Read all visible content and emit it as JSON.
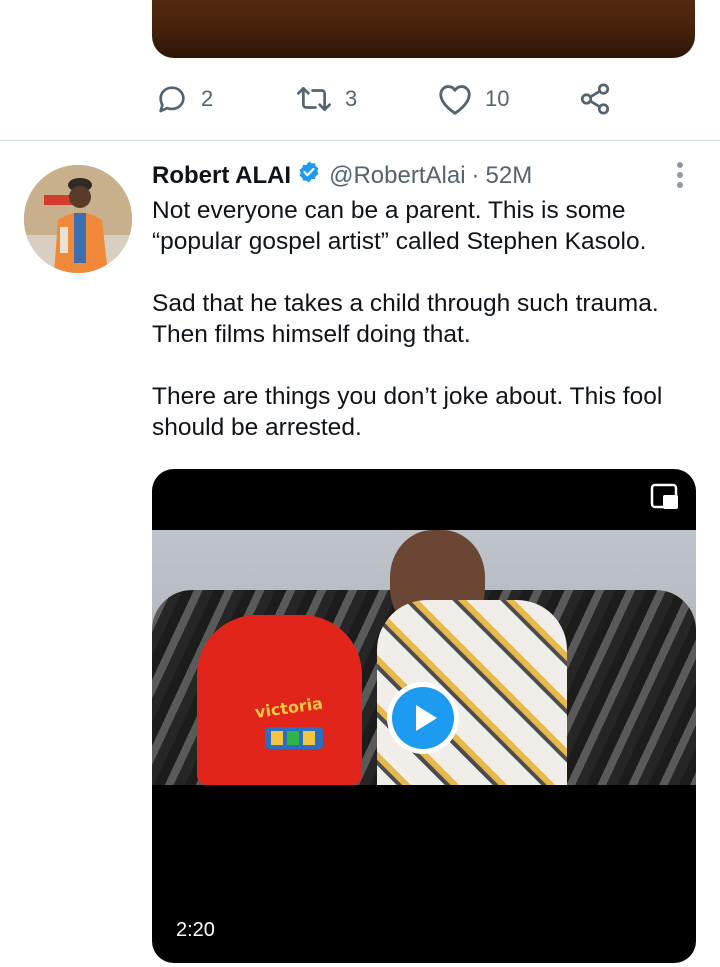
{
  "previous_tweet": {
    "actions": {
      "reply_count": "2",
      "retweet_count": "3",
      "like_count": "10"
    }
  },
  "tweet": {
    "author_name": "Robert ALAI",
    "handle": "@RobertAlai",
    "separator": "·",
    "time": "52M",
    "paragraphs": [
      "Not everyone can be a parent. This is some “popular gospel artist” called Stephen Kasolo.",
      "Sad that he takes a child through such trauma. Then films himself doing that.",
      "There are things you don’t joke about. This fool should be arrested."
    ],
    "video": {
      "duration": "2:20",
      "frame_shirt_text": "victoria"
    }
  },
  "icons": {
    "reply": "reply-icon",
    "retweet": "retweet-icon",
    "like": "heart-icon",
    "share": "share-icon",
    "verified": "verified-badge-icon",
    "more": "more-options-icon",
    "play": "play-icon",
    "pip": "picture-in-picture-icon"
  },
  "colors": {
    "text": "#0f1419",
    "secondary": "#536471",
    "verified": "#1d9bf0",
    "divider": "#cfd9de"
  }
}
